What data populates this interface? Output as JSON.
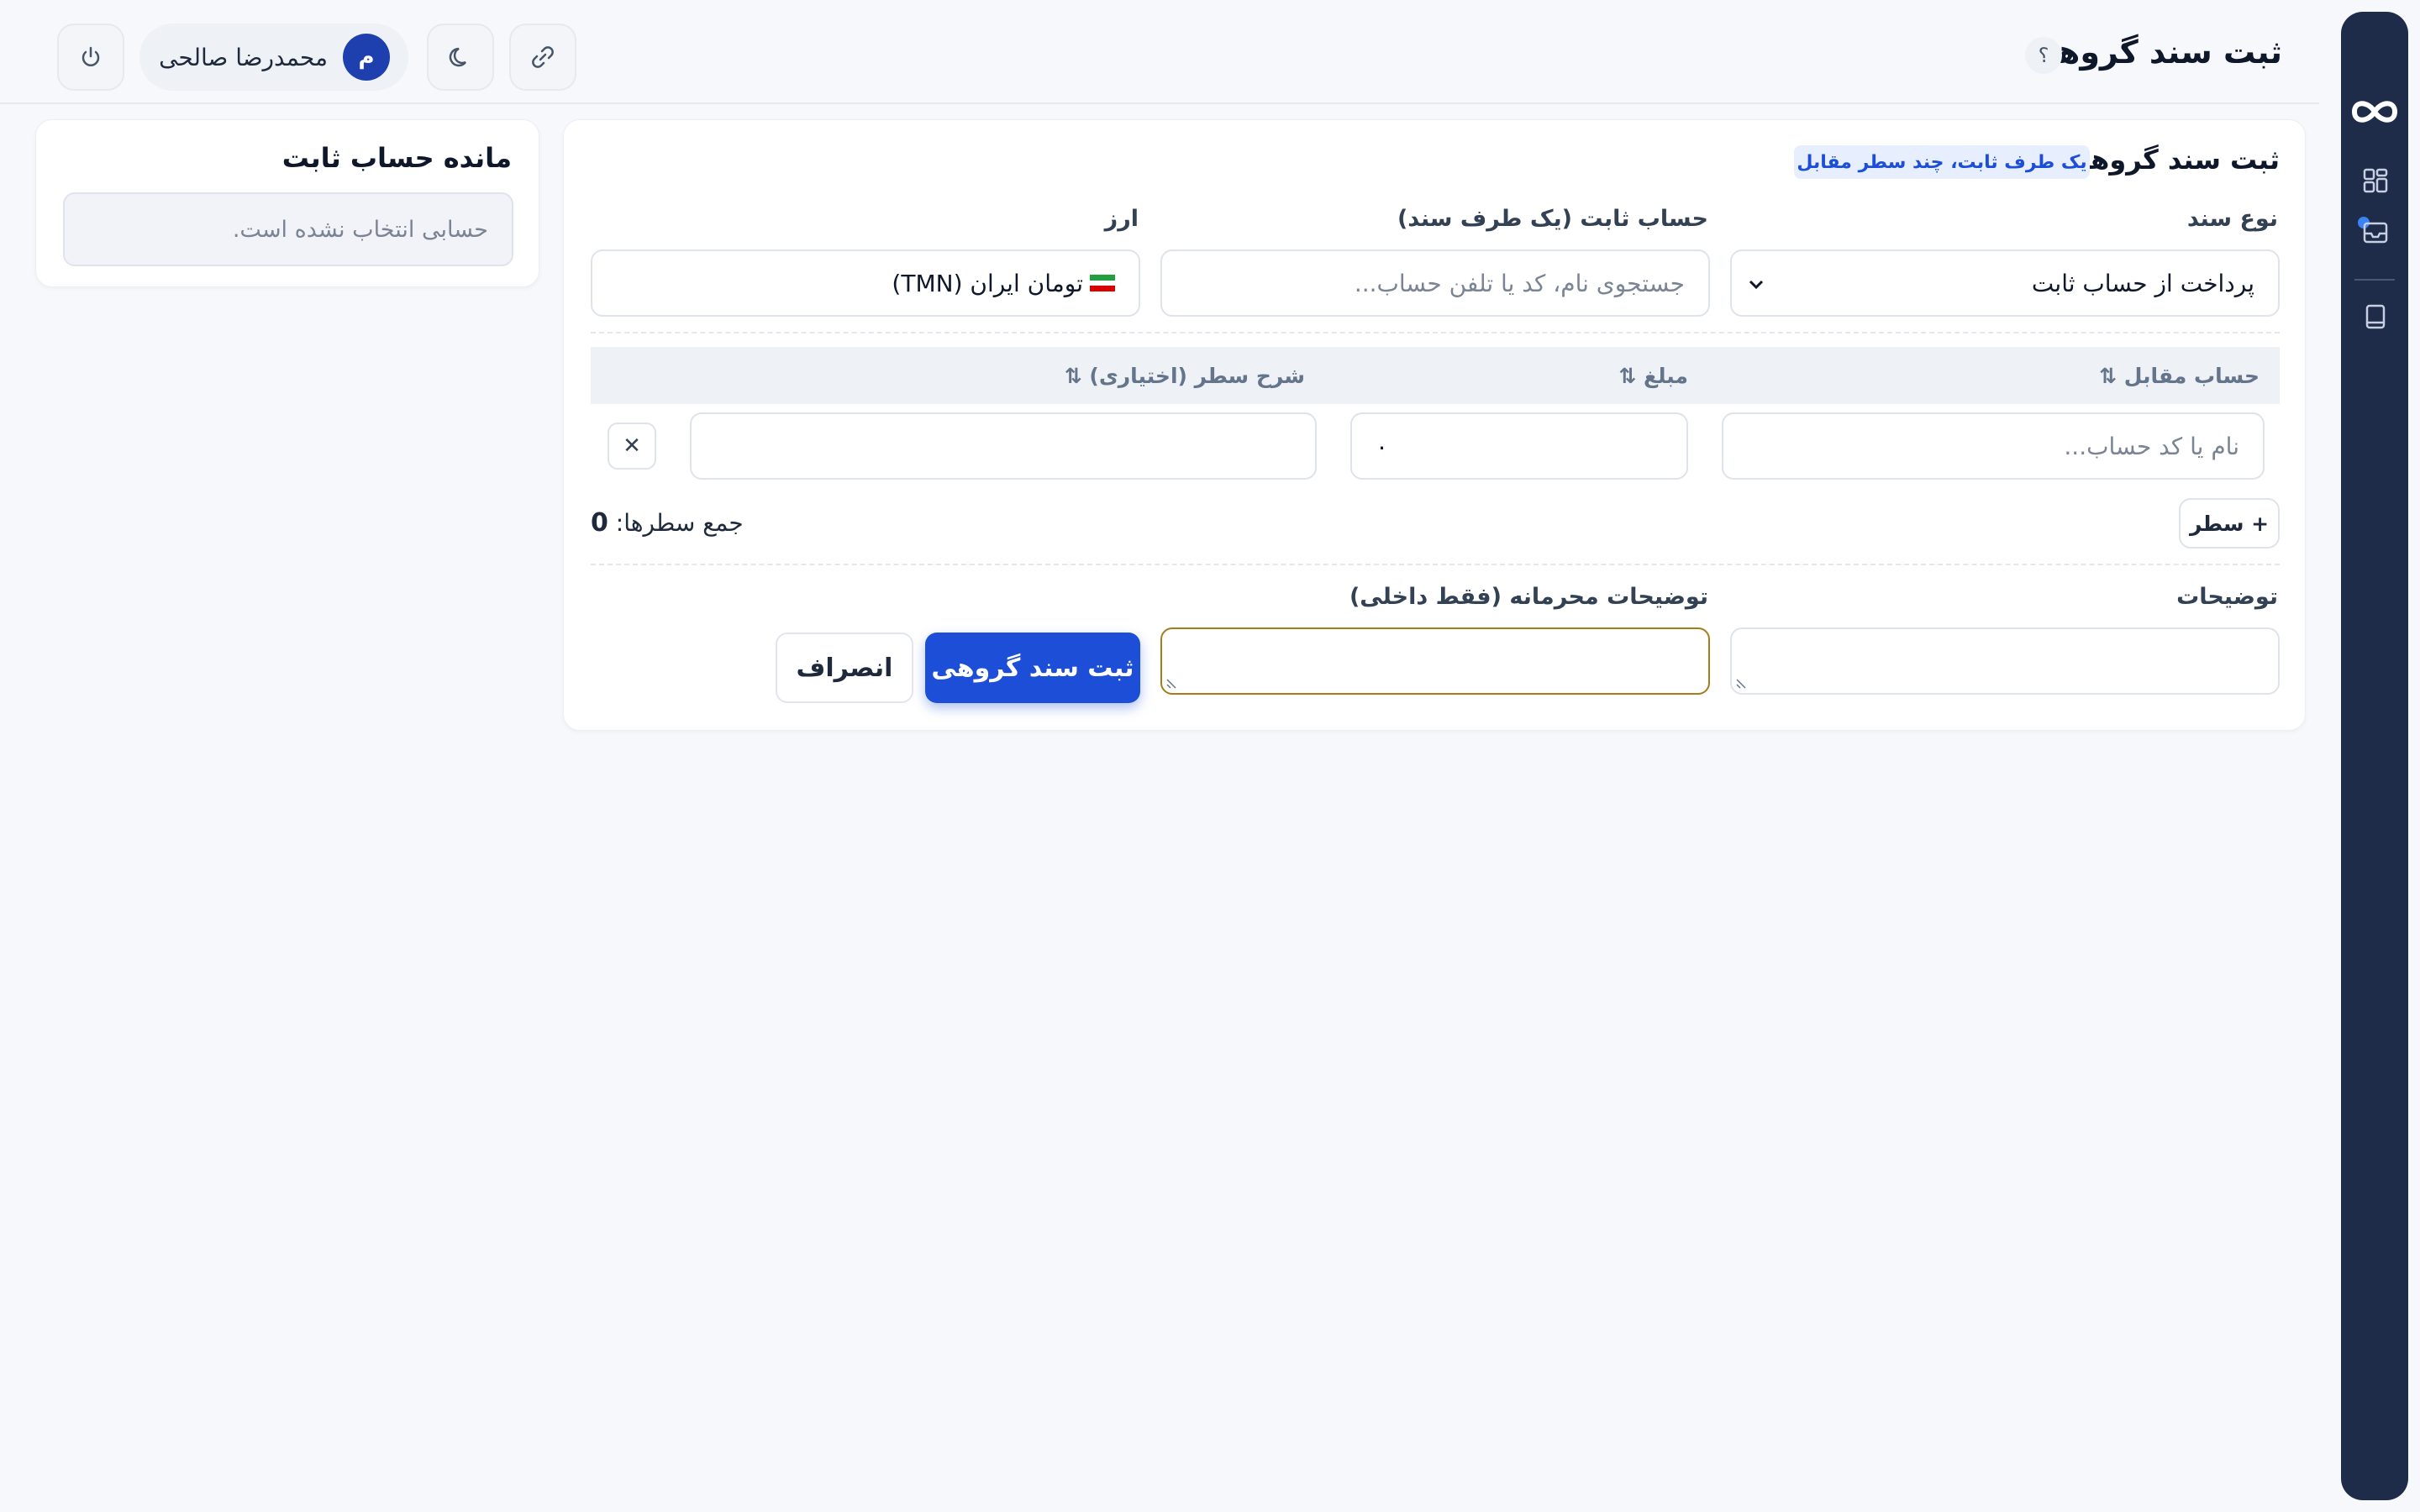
{
  "header": {
    "title": "ثبت سند گروهی",
    "help": "؟",
    "user_name": "محمدرضا صالحی",
    "avatar_initial": "م"
  },
  "form": {
    "title": "ثبت سند گروهی",
    "tag": "یک طرف ثابت، چند سطر مقابل",
    "doc_type_label": "نوع سند",
    "doc_type_value": "پرداخت از حساب ثابت",
    "fixed_account_label": "حساب ثابت (یک طرف سند)",
    "fixed_account_placeholder": "جستجوی نام، کد یا تلفن حساب...",
    "currency_label": "ارز",
    "currency_value": "تومان ایران (TMN)",
    "columns": [
      "حساب مقابل ⇅",
      "مبلغ ⇅",
      "شرح سطر (اختیاری) ⇅"
    ],
    "row": {
      "account_placeholder": "نام یا کد حساب...",
      "amount_value": "۰",
      "remove": "✕"
    },
    "add_row": "+ سطر",
    "sum_label": "جمع سطرها:",
    "sum_value": "0",
    "notes_label": "توضیحات",
    "private_notes_label": "توضیحات محرمانه (فقط داخلی)",
    "submit": "ثبت سند گروهی",
    "cancel": "انصراف"
  },
  "balance": {
    "title": "مانده حساب ثابت",
    "empty": "حسابی انتخاب نشده است."
  },
  "colors": {
    "sidebar": "#1e2b49",
    "primary": "#1d4ed8",
    "focus_border": "#a57c1b"
  }
}
